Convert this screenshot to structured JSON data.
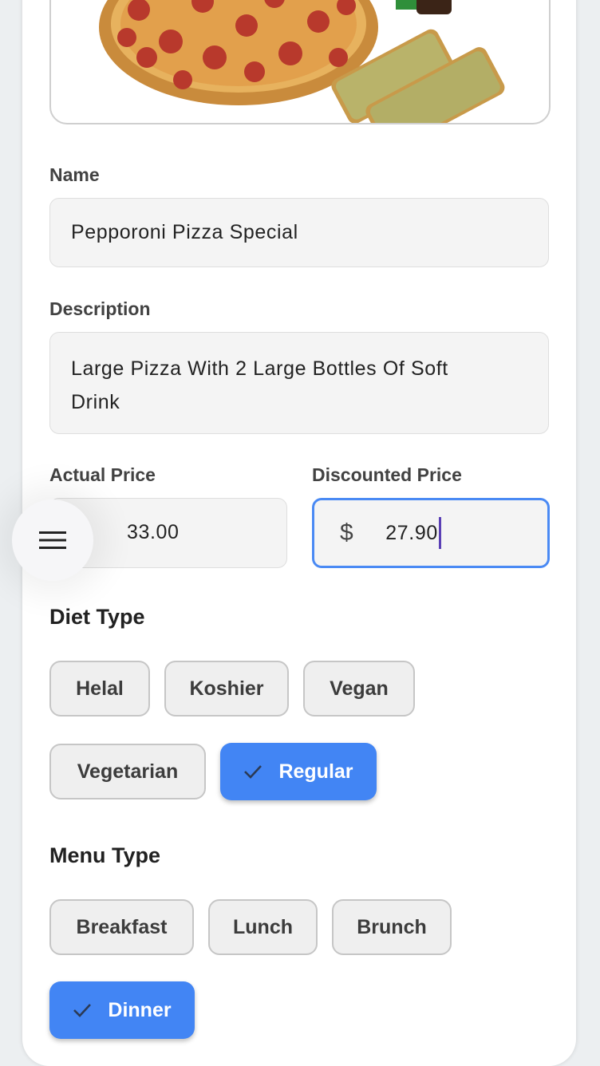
{
  "form": {
    "name": {
      "label": "Name",
      "value": "Pepporoni Pizza Special"
    },
    "description": {
      "label": "Description",
      "value": "Large Pizza With 2 Large Bottles Of Soft Drink"
    },
    "actual_price": {
      "label": "Actual Price",
      "value": "33.00"
    },
    "discounted_price": {
      "label": "Discounted Price",
      "currency": "$",
      "value": "27.90"
    }
  },
  "diet_type": {
    "title": "Diet Type",
    "options": [
      {
        "label": "Helal",
        "selected": false
      },
      {
        "label": "Koshier",
        "selected": false
      },
      {
        "label": "Vegan",
        "selected": false
      },
      {
        "label": "Vegetarian",
        "selected": false
      },
      {
        "label": "Regular",
        "selected": true
      }
    ]
  },
  "menu_type": {
    "title": "Menu Type",
    "options": [
      {
        "label": "Breakfast",
        "selected": false
      },
      {
        "label": "Lunch",
        "selected": false
      },
      {
        "label": "Brunch",
        "selected": false
      },
      {
        "label": "Dinner",
        "selected": true
      }
    ]
  },
  "colors": {
    "accent": "#4285f4",
    "focus_border": "#4a8af4",
    "cursor": "#5a3fb5",
    "chip_bg": "#efefef",
    "field_bg": "#f4f4f4"
  },
  "icons": {
    "menu": "hamburger-menu-icon",
    "check": "check-icon"
  }
}
